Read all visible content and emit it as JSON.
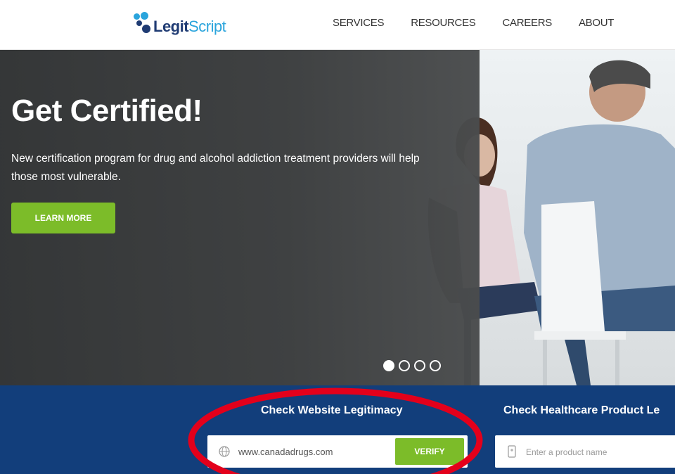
{
  "header": {
    "logo": {
      "part1": "Legit",
      "part2": "Script"
    },
    "nav": [
      "SERVICES",
      "RESOURCES",
      "CAREERS",
      "ABOUT"
    ]
  },
  "hero": {
    "title": "Get Certified!",
    "text": "New certification program for drug and alcohol addiction treatment providers will help those most vulnerable.",
    "button": "LEARN MORE",
    "slides": {
      "count": 4,
      "active": 1
    }
  },
  "search_band": {
    "website_title": "Check Website Legitimacy",
    "website_value": "www.canadadrugs.com",
    "verify_label": "VERIFY",
    "product_title": "Check Healthcare Product Le",
    "product_placeholder": "Enter a product name"
  },
  "colors": {
    "brand_navy": "#1f3b73",
    "brand_blue": "#2aa4dc",
    "band": "#123e7b",
    "accent_green": "#7cbc29",
    "annotation": "#e3001b"
  },
  "icons": [
    "logo-dots-icon",
    "globe-icon",
    "product-icon"
  ]
}
